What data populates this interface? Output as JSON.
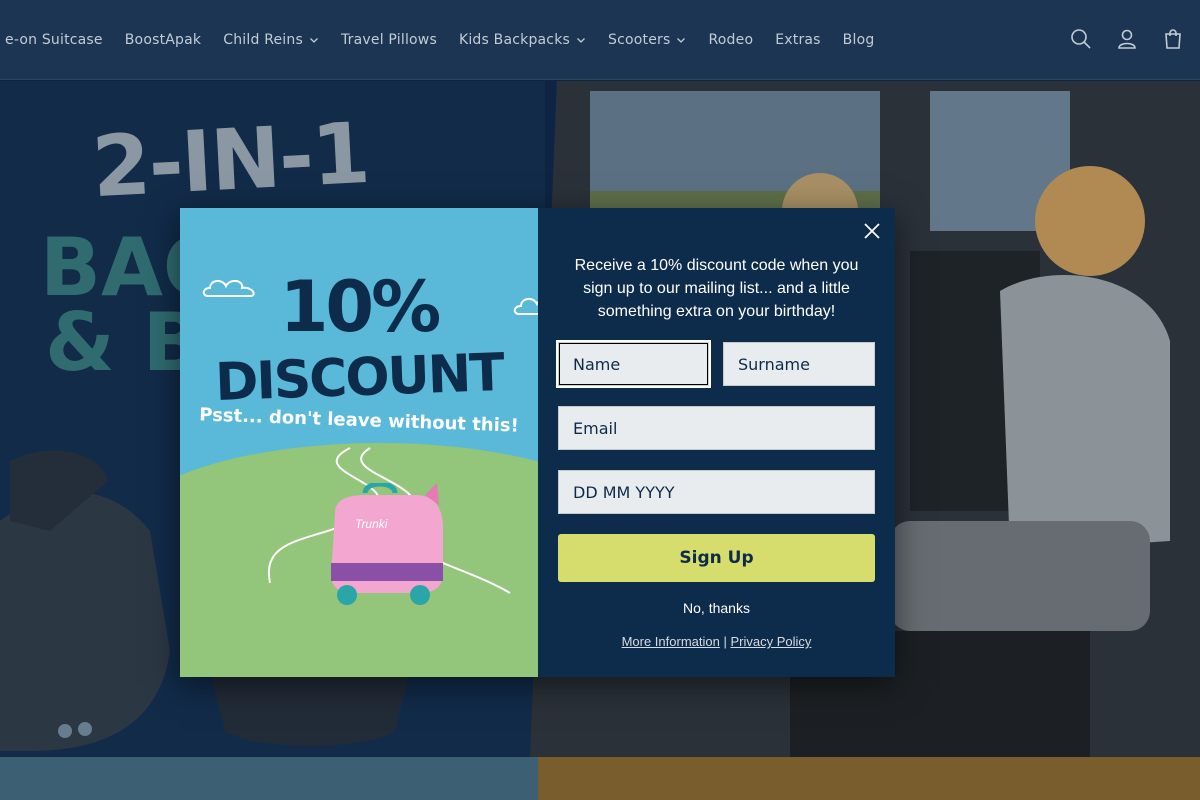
{
  "nav": {
    "links": [
      {
        "label": "e-on Suitcase",
        "dropdown": false
      },
      {
        "label": "BoostApak",
        "dropdown": false
      },
      {
        "label": "Child Reins",
        "dropdown": true
      },
      {
        "label": "Travel Pillows",
        "dropdown": false
      },
      {
        "label": "Kids Backpacks",
        "dropdown": true
      },
      {
        "label": "Scooters",
        "dropdown": true
      },
      {
        "label": "Rodeo",
        "dropdown": false
      },
      {
        "label": "Extras",
        "dropdown": false
      },
      {
        "label": "Blog",
        "dropdown": false
      }
    ],
    "icons": [
      "search-icon",
      "account-icon",
      "cart-icon"
    ]
  },
  "hero": {
    "title": "2-IN-1",
    "sub1": "BAC",
    "sub2": "& BO"
  },
  "popup": {
    "promo_percent": "10%",
    "promo_word": "DISCOUNT",
    "promo_tagline": "Psst... don't leave without this!",
    "suitcase_label": "Trunki",
    "intro": "Receive a 10% discount code when you sign up to our mailing list... and a little something extra on your birthday!",
    "fields": {
      "name_placeholder": "Name",
      "surname_placeholder": "Surname",
      "email_placeholder": "Email",
      "dob_placeholder": "DD MM YYYY"
    },
    "signup_label": "Sign Up",
    "decline_label": "No, thanks",
    "more_info_label": "More Information",
    "separator": "|",
    "privacy_label": "Privacy Policy"
  },
  "colors": {
    "nav_bg": "#1b3552",
    "popup_form_bg": "#0d2b4a",
    "signup_bg": "#d6dd6c",
    "popup_img_bg": "#5ab8d9"
  }
}
